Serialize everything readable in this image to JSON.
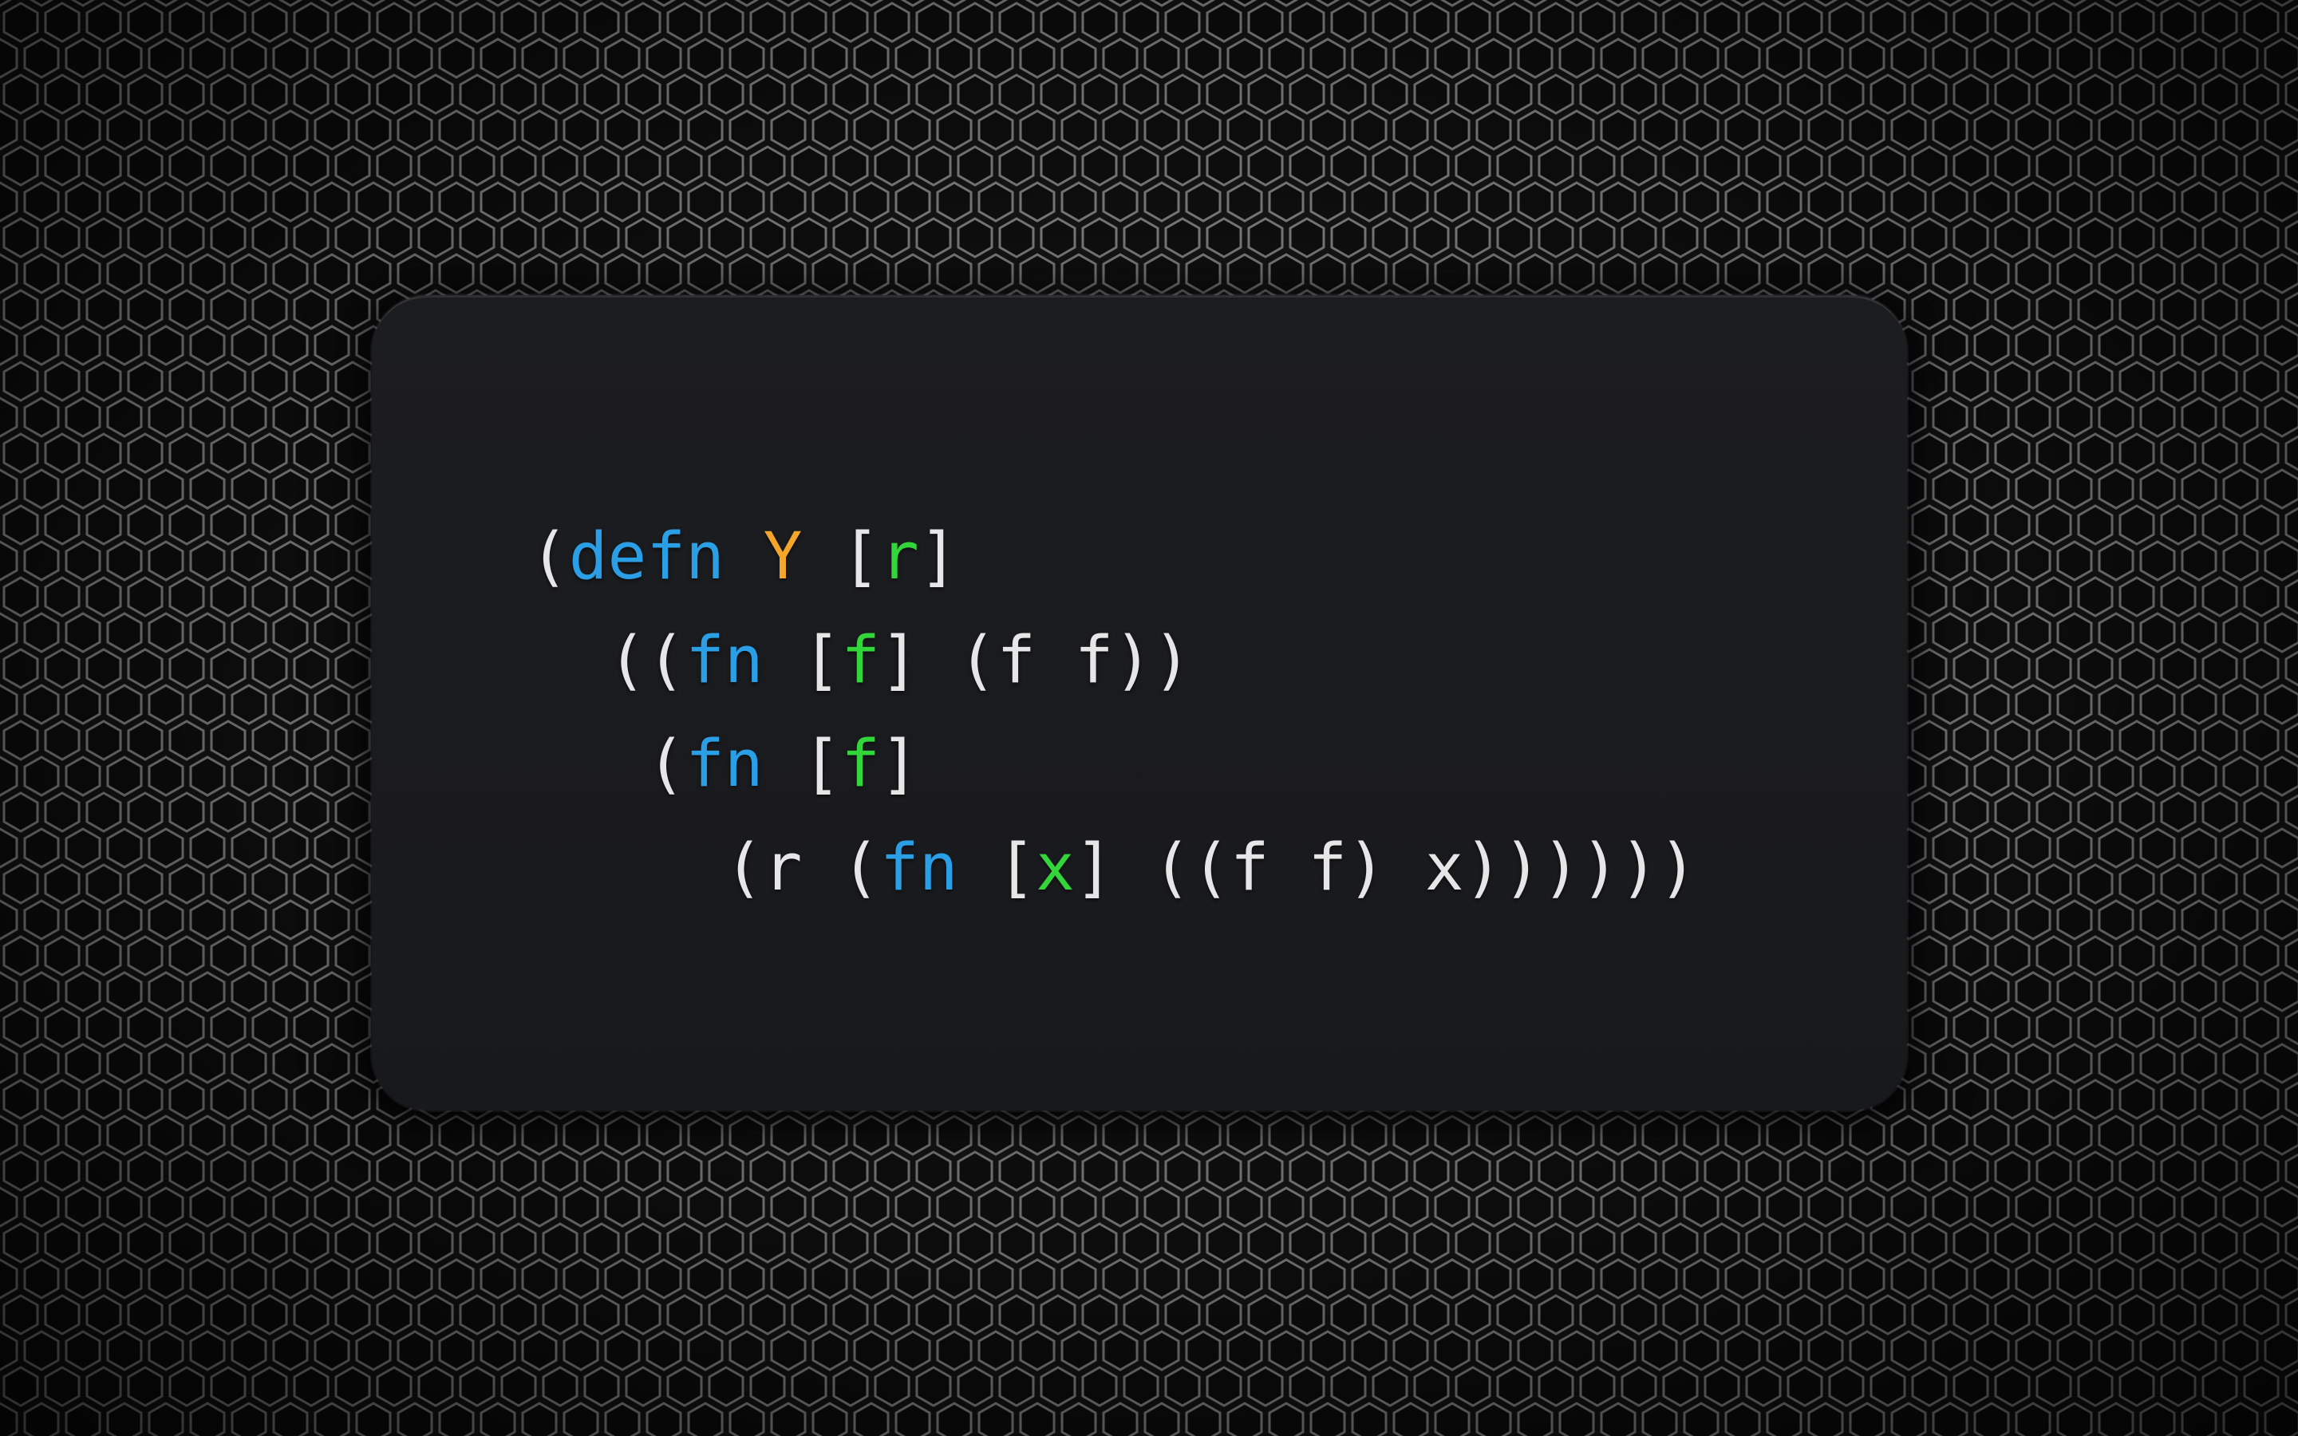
{
  "wallpaper": {
    "pattern": "hexagon-mesh",
    "base_color": "#141414",
    "line_color": "#9a9a9a"
  },
  "code_card": {
    "background_color": "#1b1c1f",
    "lines": [
      {
        "indent": "",
        "tokens": [
          {
            "text": "(",
            "kind": "punc"
          },
          {
            "text": "defn",
            "kind": "kw"
          },
          {
            "text": " ",
            "kind": "sym"
          },
          {
            "text": "Y",
            "kind": "name"
          },
          {
            "text": " [",
            "kind": "punc"
          },
          {
            "text": "r",
            "kind": "param"
          },
          {
            "text": "]",
            "kind": "punc"
          }
        ]
      },
      {
        "indent": "  ",
        "tokens": [
          {
            "text": "((",
            "kind": "punc"
          },
          {
            "text": "fn",
            "kind": "kw"
          },
          {
            "text": " [",
            "kind": "punc"
          },
          {
            "text": "f",
            "kind": "param"
          },
          {
            "text": "] (f f))",
            "kind": "punc"
          }
        ]
      },
      {
        "indent": "   ",
        "tokens": [
          {
            "text": "(",
            "kind": "punc"
          },
          {
            "text": "fn",
            "kind": "kw"
          },
          {
            "text": " [",
            "kind": "punc"
          },
          {
            "text": "f",
            "kind": "param"
          },
          {
            "text": "]",
            "kind": "punc"
          }
        ]
      },
      {
        "indent": "     ",
        "tokens": [
          {
            "text": "(r (",
            "kind": "punc"
          },
          {
            "text": "fn",
            "kind": "kw"
          },
          {
            "text": " [",
            "kind": "punc"
          },
          {
            "text": "x",
            "kind": "param"
          },
          {
            "text": "] ((f f) x))))))",
            "kind": "punc"
          }
        ]
      }
    ],
    "colors": {
      "punc": "#e6e6e6",
      "kw": "#2a9fe6",
      "name": "#f4a62a",
      "param": "#33d63a"
    }
  }
}
